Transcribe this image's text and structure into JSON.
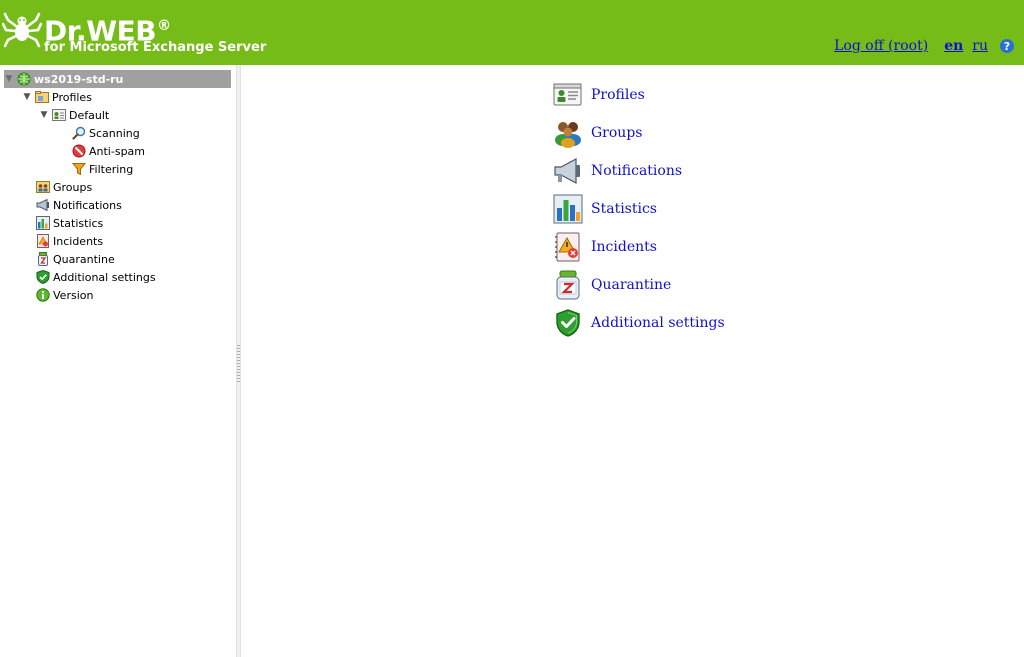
{
  "header": {
    "brand": "Dr.WEB",
    "registered": "®",
    "subtitle": "for Microsoft Exchange Server",
    "logoff_label": "Log off (root)",
    "lang_en": "en",
    "lang_ru": "ru",
    "help_glyph": "?",
    "background_color": "#76bc18"
  },
  "sidebar": {
    "root": "ws2019-std-ru",
    "profiles": "Profiles",
    "default": "Default",
    "scanning": "Scanning",
    "antispam": "Anti-spam",
    "filtering": "Filtering",
    "groups": "Groups",
    "notifications": "Notifications",
    "statistics": "Statistics",
    "incidents": "Incidents",
    "quarantine": "Quarantine",
    "additional_settings": "Additional settings",
    "version": "Version"
  },
  "main": {
    "links": {
      "profiles": "Profiles",
      "groups": "Groups",
      "notifications": "Notifications",
      "statistics": "Statistics",
      "incidents": "Incidents",
      "quarantine": "Quarantine",
      "additional_settings": "Additional settings"
    },
    "link_color": "#1010cc"
  },
  "icons": {
    "root": "server-globe-icon",
    "profiles": "folder-icon",
    "default": "profile-card-icon",
    "scanning": "magnifier-icon",
    "antispam": "no-entry-icon",
    "filtering": "funnel-icon",
    "groups": "users-icon",
    "notifications": "megaphone-icon",
    "statistics": "bar-chart-icon",
    "incidents": "warning-notebook-icon",
    "quarantine": "medicine-jar-icon",
    "additional_settings": "shield-check-icon",
    "version": "info-icon"
  }
}
